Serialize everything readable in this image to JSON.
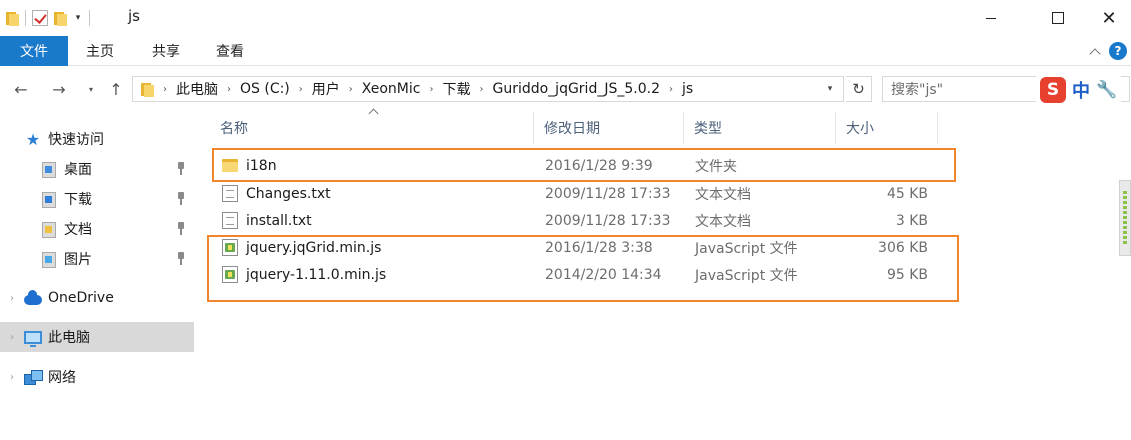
{
  "window": {
    "title": "js",
    "minimize_glyph": "",
    "maximize_glyph": "",
    "close_glyph": "✕"
  },
  "ribbon": {
    "tabs": [
      "文件",
      "主页",
      "共享",
      "查看"
    ]
  },
  "navigation": {
    "back_glyph": "←",
    "forward_glyph": "→",
    "recent_glyph": "▾",
    "up_glyph": "↑",
    "refresh_glyph": "↻",
    "breadcrumb": [
      "此电脑",
      "OS (C:)",
      "用户",
      "XeonMic",
      "下载",
      "Guriddo_jqGrid_JS_5.0.2",
      "js"
    ],
    "search_placeholder": "搜索\"js\""
  },
  "ime": {
    "logo": "S",
    "mode": "中",
    "tool_glyph": "🔧"
  },
  "nav_pane": {
    "quick_access": "快速访问",
    "pinned": [
      "桌面",
      "下载",
      "文档",
      "图片"
    ],
    "onedrive": "OneDrive",
    "this_pc": "此电脑",
    "network": "网络"
  },
  "columns": [
    "名称",
    "修改日期",
    "类型",
    "大小"
  ],
  "files": [
    {
      "name": "i18n",
      "date": "2016/1/28 9:39",
      "type": "文件夹",
      "size": "",
      "icon": "folder-icon"
    },
    {
      "name": "Changes.txt",
      "date": "2009/11/28 17:33",
      "type": "文本文档",
      "size": "45 KB",
      "icon": "text-file-icon"
    },
    {
      "name": "install.txt",
      "date": "2009/11/28 17:33",
      "type": "文本文档",
      "size": "3 KB",
      "icon": "text-file-icon"
    },
    {
      "name": "jquery.jqGrid.min.js",
      "date": "2016/1/28 3:38",
      "type": "JavaScript 文件",
      "size": "306 KB",
      "icon": "javascript-file-icon"
    },
    {
      "name": "jquery-1.11.0.min.js",
      "date": "2014/2/20 14:34",
      "type": "JavaScript 文件",
      "size": "95 KB",
      "icon": "javascript-file-icon"
    }
  ],
  "colors": {
    "ribbon_file_tab": "#1979ca",
    "highlight_box": "#f0852c",
    "selected_nav_bg": "#d9d9d9"
  }
}
